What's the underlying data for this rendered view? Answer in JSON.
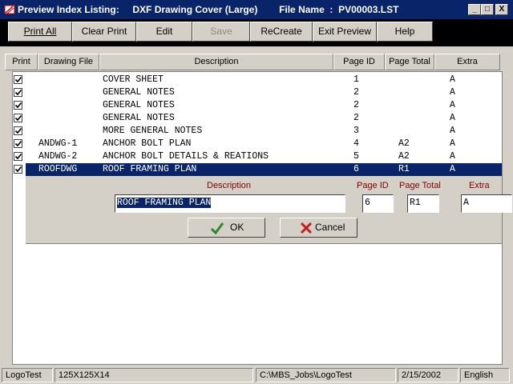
{
  "window": {
    "title": "Preview Index Listing:     DXF Drawing Cover (Large)        File Name  :  PV00003.LST",
    "minimize": "_",
    "maximize": "□",
    "close": "X"
  },
  "toolbar": {
    "buttons": [
      {
        "label": "Print All",
        "enabled": true
      },
      {
        "label": "Clear Print",
        "enabled": true
      },
      {
        "label": "Edit",
        "enabled": true
      },
      {
        "label": "Save",
        "enabled": false
      },
      {
        "label": "ReCreate",
        "enabled": true
      },
      {
        "label": "Exit Preview",
        "enabled": true
      },
      {
        "label": "Help",
        "enabled": true
      }
    ]
  },
  "grid": {
    "columns": [
      "Print",
      "Drawing File",
      "Description",
      "Page ID",
      "Page Total",
      "Extra"
    ],
    "rows": [
      {
        "print": true,
        "file": "",
        "description": "COVER SHEET",
        "page_id": "1",
        "page_total": "",
        "extra": "A"
      },
      {
        "print": true,
        "file": "",
        "description": "GENERAL NOTES",
        "page_id": "2",
        "page_total": "",
        "extra": "A"
      },
      {
        "print": true,
        "file": "",
        "description": "GENERAL NOTES",
        "page_id": "2",
        "page_total": "",
        "extra": "A"
      },
      {
        "print": true,
        "file": "",
        "description": "GENERAL NOTES",
        "page_id": "2",
        "page_total": "",
        "extra": "A"
      },
      {
        "print": true,
        "file": "",
        "description": "MORE GENERAL NOTES",
        "page_id": "3",
        "page_total": "",
        "extra": "A"
      },
      {
        "print": true,
        "file": "ANDWG-1",
        "description": "ANCHOR BOLT PLAN",
        "page_id": "4",
        "page_total": "A2",
        "extra": "A"
      },
      {
        "print": true,
        "file": "ANDWG-2",
        "description": "ANCHOR BOLT DETAILS & REATIONS",
        "page_id": "5",
        "page_total": "A2",
        "extra": "A"
      },
      {
        "print": true,
        "file": "ROOFDWG",
        "description": "ROOF FRAMING PLAN",
        "page_id": "6",
        "page_total": "R1",
        "extra": "A",
        "selected": true
      }
    ]
  },
  "editor": {
    "description_label": "Description",
    "page_id_label": "Page ID",
    "page_total_label": "Page Total",
    "extra_label": "Extra",
    "description_value": "ROOF FRAMING PLAN",
    "page_id_value": "6",
    "page_total_value": "R1",
    "extra_value": "A",
    "ok_label": "OK",
    "cancel_label": "Cancel"
  },
  "statusbar": {
    "cells": [
      "LogoTest",
      "125X125X14",
      "",
      "C:\\MBS_Jobs\\LogoTest",
      "2/15/2002",
      "English"
    ]
  },
  "colors": {
    "selection": "#0a246a",
    "label_red": "#800000",
    "ok_green": "#2a8a2a",
    "cancel_red": "#c02020"
  }
}
